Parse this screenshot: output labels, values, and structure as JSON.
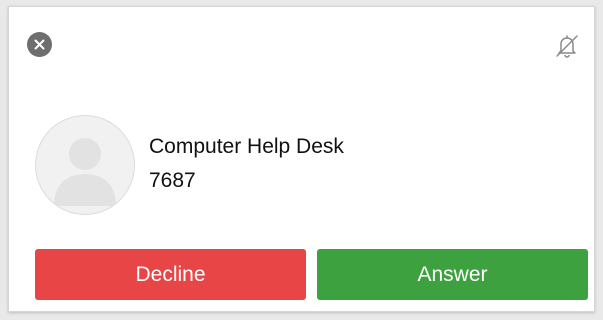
{
  "call": {
    "caller_name": "Computer Help Desk",
    "caller_number": "7687"
  },
  "actions": {
    "decline_label": "Decline",
    "answer_label": "Answer"
  },
  "icons": {
    "close": "close-icon",
    "mute": "bell-slash-icon",
    "avatar": "person-placeholder-icon"
  },
  "colors": {
    "decline": "#e84646",
    "answer": "#3da13f",
    "close_circle": "#6e6e6e"
  }
}
